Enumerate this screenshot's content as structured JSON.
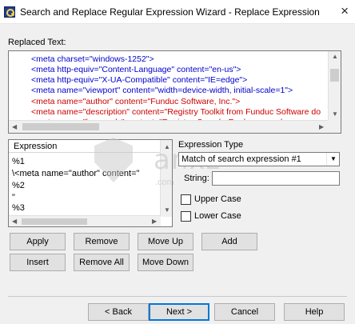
{
  "window": {
    "title": "Search and Replace Regular Expression Wizard - Replace Expression",
    "close_glyph": "×"
  },
  "replaced_text": {
    "label": "Replaced Text:",
    "lines": [
      {
        "text": "<meta charset=\"windows-1252\">",
        "color": "#0000cc"
      },
      {
        "text": "<meta http-equiv=\"Content-Language\" content=\"en-us\">",
        "color": "#0000cc"
      },
      {
        "text": "<meta http-equiv=\"X-UA-Compatible\" content=\"IE=edge\">",
        "color": "#0000cc"
      },
      {
        "text": "<meta name=\"viewport\" content=\"width=device-width, initial-scale=1\">",
        "color": "#0000cc"
      },
      {
        "text": "<meta name=\"author\" content=\"Funduc Software, Inc.\">",
        "color": "#cc0000"
      },
      {
        "text": "<meta name=\"description\" content=\"Registry Toolkit from Funduc Software do",
        "color": "#cc0000"
      },
      {
        "text": "<meta name=\"keywords\" content=\"Registry, Search, Replace, regular expres",
        "color": "#cc0000"
      }
    ]
  },
  "expression_list": {
    "header": "Expression",
    "rows": [
      "%1",
      "\\<meta name=\"author\" content=\"",
      "%2",
      "\"",
      "%3"
    ]
  },
  "expression_type": {
    "label": "Expression Type",
    "selected": "Match of search expression #1",
    "string_label": "String:",
    "string_value": "",
    "upper_case_label": "Upper Case",
    "lower_case_label": "Lower Case",
    "upper_case_checked": false,
    "lower_case_checked": false
  },
  "actions": {
    "apply": "Apply",
    "remove": "Remove",
    "move_up": "Move Up",
    "add": "Add",
    "insert": "Insert",
    "remove_all": "Remove All",
    "move_down": "Move Down"
  },
  "footer": {
    "back": "< Back",
    "next": "Next >",
    "cancel": "Cancel",
    "help": "Help"
  },
  "watermark": {
    "text": "anxz",
    "sub": ".com"
  },
  "colors": {
    "dialog_bg": "#f0f0f0",
    "accent_blue": "#0000cc",
    "accent_red": "#cc0000",
    "default_button_border": "#0078d7"
  }
}
